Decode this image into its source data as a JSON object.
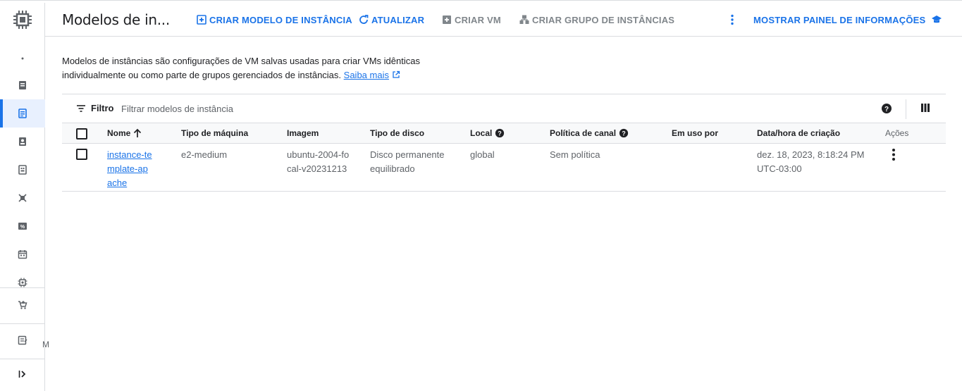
{
  "header": {
    "title": "Modelos de in...",
    "create_template": "CRIAR MODELO DE INSTÂNCIA",
    "refresh": "ATUALIZAR",
    "create_vm": "CRIAR VM",
    "create_group": "CRIAR GRUPO DE INSTÂNCIAS",
    "info_panel": "MOSTRAR PAINEL DE INFORMAÇÕES"
  },
  "description": {
    "text": "Modelos de instâncias são configurações de VM salvas usadas para criar VMs idênticas individualmente ou como parte de grupos gerenciados de instâncias.",
    "learn_more": "Saiba mais"
  },
  "filter": {
    "label": "Filtro",
    "placeholder": "Filtrar modelos de instância"
  },
  "table": {
    "columns": [
      "Nome",
      "Tipo de máquina",
      "Imagem",
      "Tipo de disco",
      "Local",
      "Política de canal",
      "Em uso por",
      "Data/hora de criação",
      "Ações"
    ],
    "rows": [
      {
        "name": "instance-template-apache",
        "machine_type": "e2-medium",
        "image": "ubuntu-2004-focal-v20231213",
        "disk_type": "Disco permanente equilibrado",
        "location": "global",
        "policy": "Sem política",
        "in_use_by": "",
        "created": "dez. 18, 2023, 8:18:24 PM UTC-03:00"
      }
    ]
  },
  "rail": {
    "peek_text": "M"
  },
  "colors": {
    "accent": "#1a73e8",
    "text": "#202124",
    "muted": "#5f6368",
    "border": "#dadce0",
    "active_bg": "#e8f0fe"
  }
}
